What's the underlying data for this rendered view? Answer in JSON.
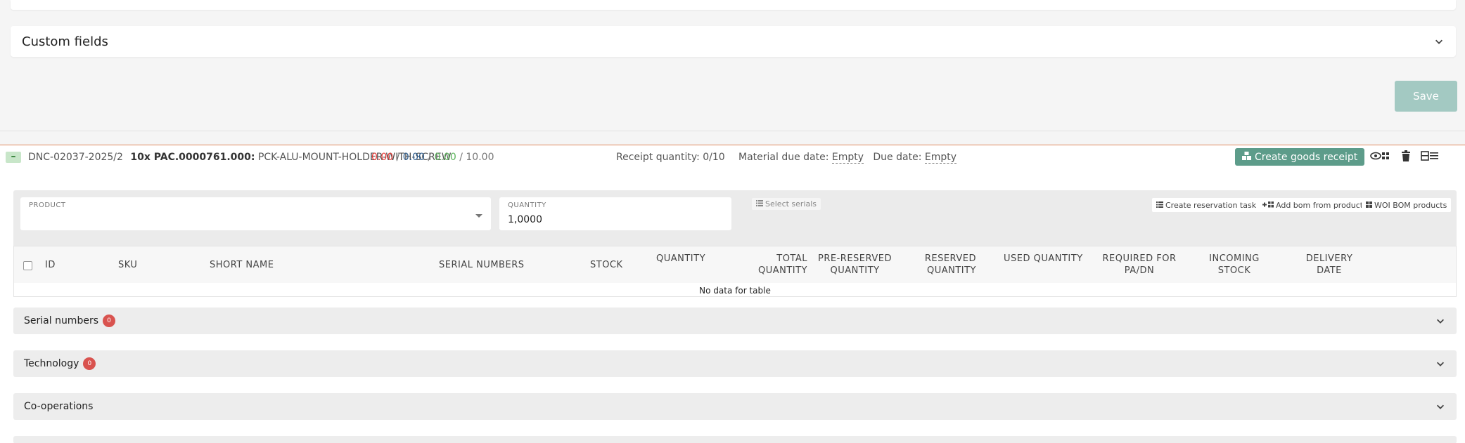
{
  "custom_fields": {
    "title": "Custom fields"
  },
  "save_label": "Save",
  "order": {
    "toggle": "–",
    "number": "DNC-02037-2025/2",
    "qty_code": "10x PAC.0000761.000:",
    "name": "PCK-ALU-MOUNT-HOLDER-WITH-SCREW",
    "amounts": {
      "a": "0.00",
      "b": "0.00",
      "c": "0.00",
      "d": "10.00",
      "sep": "/"
    },
    "receipt_quantity": "Receipt quantity: 0/10",
    "material_due_label": "Material due date:",
    "material_due_value": "Empty",
    "due_label": "Due date:",
    "due_value": "Empty",
    "create_receipt": "Create goods receipt"
  },
  "form": {
    "product_label": "PRODUCT",
    "product_value": "",
    "quantity_label": "QUANTITY",
    "quantity_value": "1,0000",
    "select_serials": "Select serials",
    "create_reservation": "Create reservation task",
    "add_bom": "Add bom from product",
    "woi_bom": "WOI BOM products"
  },
  "table": {
    "columns": {
      "id": "ID",
      "sku": "SKU",
      "short_name": "SHORT NAME",
      "serial_numbers": "SERIAL NUMBERS",
      "stock": "STOCK",
      "quantity": "QUANTITY",
      "total_quantity_1": "TOTAL",
      "total_quantity_2": "QUANTITY",
      "pre_reserved_1": "PRE-RESERVED",
      "pre_reserved_2": "QUANTITY",
      "reserved_1": "RESERVED",
      "reserved_2": "QUANTITY",
      "used_quantity": "USED QUANTITY",
      "required_1": "REQUIRED FOR",
      "required_2": "PA/DN",
      "incoming_1": "INCOMING",
      "incoming_2": "STOCK",
      "delivery_1": "DELIVERY",
      "delivery_2": "DATE"
    },
    "empty": "No data for table"
  },
  "accordions": [
    {
      "label": "Serial numbers",
      "badge": "0"
    },
    {
      "label": "Technology",
      "badge": "0"
    },
    {
      "label": "Co-operations"
    }
  ],
  "colors": {
    "accent": "#5d9c8a",
    "danger": "#d9534f",
    "divider": "#e0895c"
  }
}
